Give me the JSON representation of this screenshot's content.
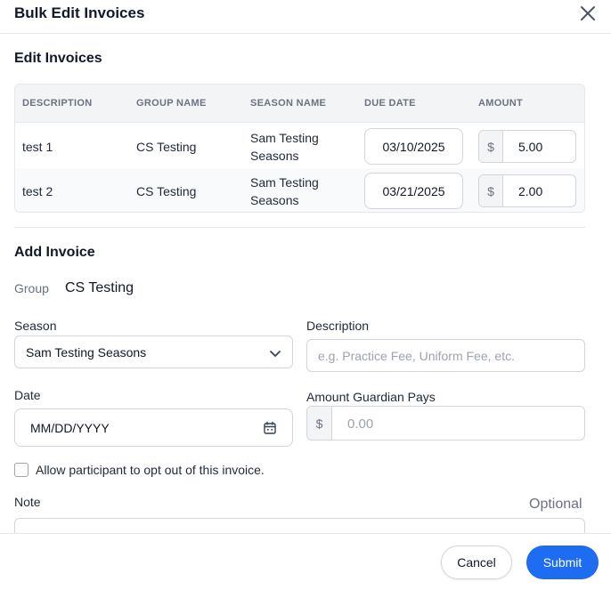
{
  "dialog": {
    "title": "Bulk Edit Invoices"
  },
  "edit_section": {
    "title": "Edit Invoices",
    "columns": [
      "DESCRIPTION",
      "GROUP NAME",
      "SEASON NAME",
      "DUE DATE",
      "AMOUNT"
    ],
    "rows": [
      {
        "description": "test 1",
        "group": "CS Testing",
        "season": "Sam Testing Seasons",
        "due_date": "03/10/2025",
        "currency": "$",
        "amount": "5.00"
      },
      {
        "description": "test 2",
        "group": "CS Testing",
        "season": "Sam Testing Seasons",
        "due_date": "03/21/2025",
        "currency": "$",
        "amount": "2.00"
      }
    ]
  },
  "add_section": {
    "title": "Add Invoice",
    "group_label": "Group",
    "group_value": "CS Testing",
    "season_label": "Season",
    "season_value": "Sam Testing Seasons",
    "description_label": "Description",
    "description_placeholder": "e.g. Practice Fee, Uniform Fee, etc.",
    "date_label": "Date",
    "date_placeholder": "MM/DD/YYYY",
    "amount_label": "Amount Guardian Pays",
    "amount_prefix": "$",
    "amount_placeholder": "0.00",
    "opt_out_label": "Allow participant to opt out of this invoice.",
    "note_label": "Note",
    "note_optional": "Optional"
  },
  "footer": {
    "cancel_label": "Cancel",
    "submit_label": "Submit"
  },
  "colors": {
    "primary": "#1d6cf2",
    "border": "#d1d5db",
    "header_bg": "#f3f4f6"
  }
}
